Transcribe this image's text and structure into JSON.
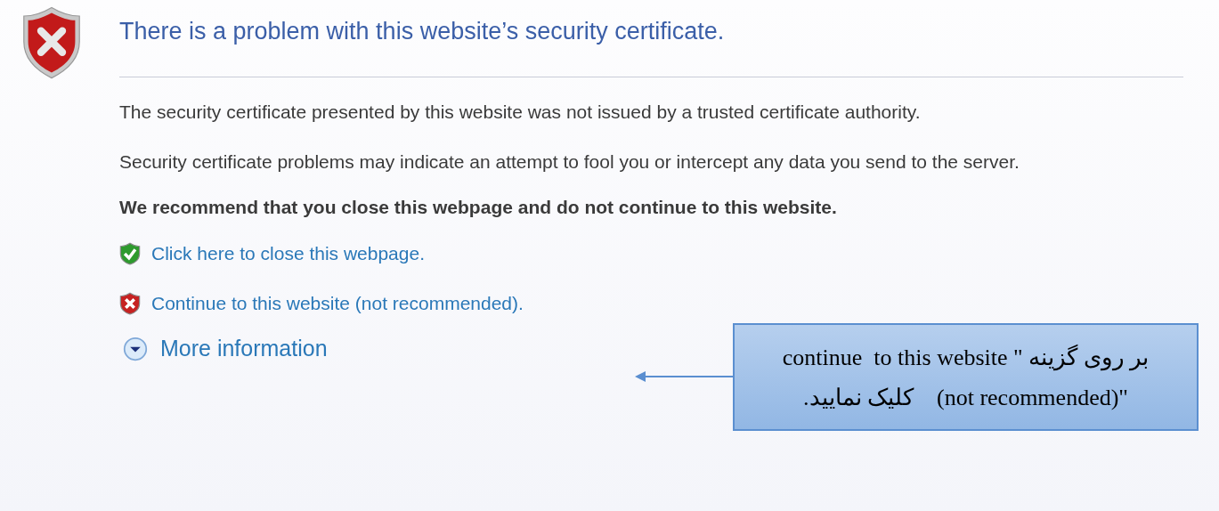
{
  "heading": "There is a problem with this website’s security certificate.",
  "paragraphs": [
    "The security certificate presented by this website was not issued by a trusted certificate authority.",
    "Security certificate problems may indicate an attempt to fool you or intercept any data you send to the server."
  ],
  "recommendation": "We recommend that you close this webpage and do not continue to this website.",
  "links": [
    {
      "kind": "safe",
      "label": "Click here to close this webpage."
    },
    {
      "kind": "unsafe",
      "label": "Continue to this website (not recommended)."
    }
  ],
  "more_information": {
    "label": "More information",
    "expanded": false
  },
  "callout": {
    "lines": [
      "بر روی گزینه \" continue  to this website",
      "\"(not recommended)    کلیک نمایید."
    ]
  }
}
